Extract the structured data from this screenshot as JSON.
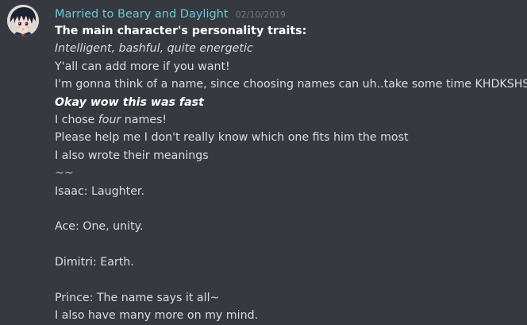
{
  "message": {
    "author": "Married to Beary and Daylight",
    "timestamp": "02/10/2019",
    "author_color": "#6fc6d8",
    "avatar_icon": "anime-character-avatar",
    "lines": {
      "l1": "The main character's personality traits:",
      "l2": "Intelligent, bashful, quite energetic",
      "l3": "Y'all can add more if you want!",
      "l4": "I'm gonna think of a name, since choosing names can uh..take some time KHDKSHSJSJ",
      "l5": "Okay wow this was fast",
      "l6_pre": "I chose ",
      "l6_em": "four",
      "l6_post": " names!",
      "l7": "Please help me I don't really know which one fits him the most",
      "l8": "I also wrote their meanings",
      "l9": "~~",
      "l10": "Isaac: Laughter.",
      "l11": "Ace: One, unity.",
      "l12": "Dimitri: Earth.",
      "l13": "Prince: The name says it all~",
      "l14": "I also have many more on my mind."
    }
  }
}
